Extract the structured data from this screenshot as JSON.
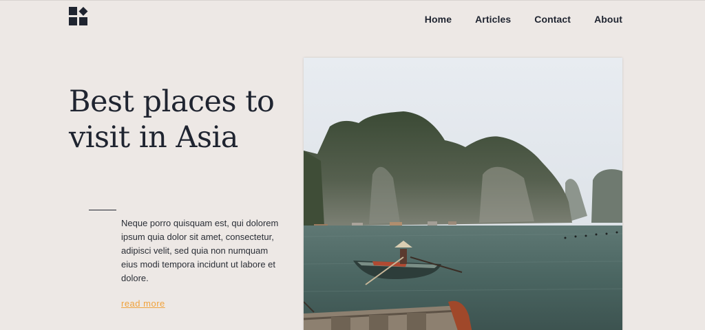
{
  "nav": {
    "items": [
      "Home",
      "Articles",
      "Contact",
      "About"
    ]
  },
  "logo": {
    "icon": "squares-diamond-logo-icon"
  },
  "hero": {
    "title_line1": "Best places to",
    "title_line2": "visit in Asia",
    "body": "Neque porro quisquam est, qui dolorem ipsum quia dolor sit amet, consectetur, adipisci velit, sed quia non numquam eius modi tempora incidunt ut labore et dolore.",
    "link": "read more",
    "image": "limestone-karsts-bay-with-rowboat"
  },
  "colors": {
    "background": "#ede8e5",
    "text": "#1f2430",
    "accent": "#f0a23c"
  }
}
